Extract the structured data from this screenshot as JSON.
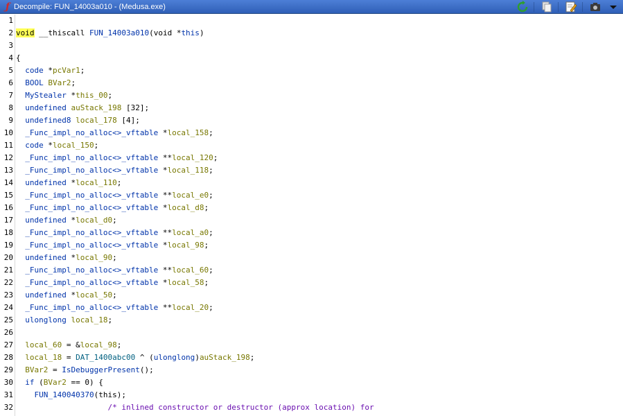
{
  "window": {
    "title": "Decompile: FUN_14003a010 -  (Medusa.exe)",
    "icon": "function-f-icon",
    "toolbar_icons": [
      "refresh-icon",
      "copy-icon",
      "edit-icon",
      "snapshot-icon",
      "dropdown-arrow-icon"
    ]
  },
  "colors": {
    "titlebar": "#2f5fb7",
    "keyword": "#0033aa",
    "variable": "#777700",
    "global": "#006080",
    "comment": "#6a0fb0",
    "highlight": "#ffff55"
  },
  "code": {
    "lines": [
      {
        "n": "1",
        "tokens": []
      },
      {
        "n": "2",
        "tokens": [
          [
            "hl",
            "void"
          ],
          [
            "t",
            " __thiscall "
          ],
          [
            "fn",
            "FUN_14003a010"
          ],
          [
            "t",
            "(void *"
          ],
          [
            "kw",
            "this"
          ],
          [
            "t",
            ")"
          ]
        ]
      },
      {
        "n": "3",
        "tokens": []
      },
      {
        "n": "4",
        "tokens": [
          [
            "t",
            "{"
          ]
        ]
      },
      {
        "n": "5",
        "tokens": [
          [
            "t",
            "  "
          ],
          [
            "ty",
            "code"
          ],
          [
            "t",
            " *"
          ],
          [
            "vr",
            "pcVar1"
          ],
          [
            "t",
            ";"
          ]
        ]
      },
      {
        "n": "6",
        "tokens": [
          [
            "t",
            "  "
          ],
          [
            "ty",
            "BOOL"
          ],
          [
            "t",
            " "
          ],
          [
            "vr",
            "BVar2"
          ],
          [
            "t",
            ";"
          ]
        ]
      },
      {
        "n": "7",
        "tokens": [
          [
            "t",
            "  "
          ],
          [
            "ty",
            "MyStealer"
          ],
          [
            "t",
            " *"
          ],
          [
            "vr",
            "this_00"
          ],
          [
            "t",
            ";"
          ]
        ]
      },
      {
        "n": "8",
        "tokens": [
          [
            "t",
            "  "
          ],
          [
            "ty",
            "undefined"
          ],
          [
            "t",
            " "
          ],
          [
            "vr",
            "auStack_198"
          ],
          [
            "t",
            " [32];"
          ]
        ]
      },
      {
        "n": "9",
        "tokens": [
          [
            "t",
            "  "
          ],
          [
            "ty",
            "undefined8"
          ],
          [
            "t",
            " "
          ],
          [
            "vr",
            "local_178"
          ],
          [
            "t",
            " [4];"
          ]
        ]
      },
      {
        "n": "10",
        "tokens": [
          [
            "t",
            "  "
          ],
          [
            "ty",
            "_Func_impl_no_alloc<>_vftable"
          ],
          [
            "t",
            " *"
          ],
          [
            "vr",
            "local_158"
          ],
          [
            "t",
            ";"
          ]
        ]
      },
      {
        "n": "11",
        "tokens": [
          [
            "t",
            "  "
          ],
          [
            "ty",
            "code"
          ],
          [
            "t",
            " *"
          ],
          [
            "vr",
            "local_150"
          ],
          [
            "t",
            ";"
          ]
        ]
      },
      {
        "n": "12",
        "tokens": [
          [
            "t",
            "  "
          ],
          [
            "ty",
            "_Func_impl_no_alloc<>_vftable"
          ],
          [
            "t",
            " **"
          ],
          [
            "vr",
            "local_120"
          ],
          [
            "t",
            ";"
          ]
        ]
      },
      {
        "n": "13",
        "tokens": [
          [
            "t",
            "  "
          ],
          [
            "ty",
            "_Func_impl_no_alloc<>_vftable"
          ],
          [
            "t",
            " *"
          ],
          [
            "vr",
            "local_118"
          ],
          [
            "t",
            ";"
          ]
        ]
      },
      {
        "n": "14",
        "tokens": [
          [
            "t",
            "  "
          ],
          [
            "ty",
            "undefined"
          ],
          [
            "t",
            " *"
          ],
          [
            "vr",
            "local_110"
          ],
          [
            "t",
            ";"
          ]
        ]
      },
      {
        "n": "15",
        "tokens": [
          [
            "t",
            "  "
          ],
          [
            "ty",
            "_Func_impl_no_alloc<>_vftable"
          ],
          [
            "t",
            " **"
          ],
          [
            "vr",
            "local_e0"
          ],
          [
            "t",
            ";"
          ]
        ]
      },
      {
        "n": "16",
        "tokens": [
          [
            "t",
            "  "
          ],
          [
            "ty",
            "_Func_impl_no_alloc<>_vftable"
          ],
          [
            "t",
            " *"
          ],
          [
            "vr",
            "local_d8"
          ],
          [
            "t",
            ";"
          ]
        ]
      },
      {
        "n": "17",
        "tokens": [
          [
            "t",
            "  "
          ],
          [
            "ty",
            "undefined"
          ],
          [
            "t",
            " *"
          ],
          [
            "vr",
            "local_d0"
          ],
          [
            "t",
            ";"
          ]
        ]
      },
      {
        "n": "18",
        "tokens": [
          [
            "t",
            "  "
          ],
          [
            "ty",
            "_Func_impl_no_alloc<>_vftable"
          ],
          [
            "t",
            " **"
          ],
          [
            "vr",
            "local_a0"
          ],
          [
            "t",
            ";"
          ]
        ]
      },
      {
        "n": "19",
        "tokens": [
          [
            "t",
            "  "
          ],
          [
            "ty",
            "_Func_impl_no_alloc<>_vftable"
          ],
          [
            "t",
            " *"
          ],
          [
            "vr",
            "local_98"
          ],
          [
            "t",
            ";"
          ]
        ]
      },
      {
        "n": "20",
        "tokens": [
          [
            "t",
            "  "
          ],
          [
            "ty",
            "undefined"
          ],
          [
            "t",
            " *"
          ],
          [
            "vr",
            "local_90"
          ],
          [
            "t",
            ";"
          ]
        ]
      },
      {
        "n": "21",
        "tokens": [
          [
            "t",
            "  "
          ],
          [
            "ty",
            "_Func_impl_no_alloc<>_vftable"
          ],
          [
            "t",
            " **"
          ],
          [
            "vr",
            "local_60"
          ],
          [
            "t",
            ";"
          ]
        ]
      },
      {
        "n": "22",
        "tokens": [
          [
            "t",
            "  "
          ],
          [
            "ty",
            "_Func_impl_no_alloc<>_vftable"
          ],
          [
            "t",
            " *"
          ],
          [
            "vr",
            "local_58"
          ],
          [
            "t",
            ";"
          ]
        ]
      },
      {
        "n": "23",
        "tokens": [
          [
            "t",
            "  "
          ],
          [
            "ty",
            "undefined"
          ],
          [
            "t",
            " *"
          ],
          [
            "vr",
            "local_50"
          ],
          [
            "t",
            ";"
          ]
        ]
      },
      {
        "n": "24",
        "tokens": [
          [
            "t",
            "  "
          ],
          [
            "ty",
            "_Func_impl_no_alloc<>_vftable"
          ],
          [
            "t",
            " **"
          ],
          [
            "vr",
            "local_20"
          ],
          [
            "t",
            ";"
          ]
        ]
      },
      {
        "n": "25",
        "tokens": [
          [
            "t",
            "  "
          ],
          [
            "ty",
            "ulonglong"
          ],
          [
            "t",
            " "
          ],
          [
            "vr",
            "local_18"
          ],
          [
            "t",
            ";"
          ]
        ]
      },
      {
        "n": "26",
        "tokens": []
      },
      {
        "n": "27",
        "tokens": [
          [
            "t",
            "  "
          ],
          [
            "vr",
            "local_60"
          ],
          [
            "t",
            " = &"
          ],
          [
            "vr",
            "local_98"
          ],
          [
            "t",
            ";"
          ]
        ]
      },
      {
        "n": "28",
        "tokens": [
          [
            "t",
            "  "
          ],
          [
            "vr",
            "local_18"
          ],
          [
            "t",
            " = "
          ],
          [
            "gl",
            "DAT_1400abc00"
          ],
          [
            "t",
            " ^ ("
          ],
          [
            "ty",
            "ulonglong"
          ],
          [
            "t",
            ")"
          ],
          [
            "vr",
            "auStack_198"
          ],
          [
            "t",
            ";"
          ]
        ]
      },
      {
        "n": "29",
        "tokens": [
          [
            "t",
            "  "
          ],
          [
            "vr",
            "BVar2"
          ],
          [
            "t",
            " = "
          ],
          [
            "fn",
            "IsDebuggerPresent"
          ],
          [
            "t",
            "();"
          ]
        ]
      },
      {
        "n": "30",
        "tokens": [
          [
            "t",
            "  "
          ],
          [
            "kw",
            "if"
          ],
          [
            "t",
            " ("
          ],
          [
            "vr",
            "BVar2"
          ],
          [
            "t",
            " == 0) {"
          ]
        ]
      },
      {
        "n": "31",
        "tokens": [
          [
            "t",
            "    "
          ],
          [
            "fn",
            "FUN_140040370"
          ],
          [
            "t",
            "(this);"
          ]
        ]
      },
      {
        "n": "32",
        "tokens": [
          [
            "t",
            "                    "
          ],
          [
            "cm",
            "/* inlined constructor or destructor (approx location) for"
          ]
        ]
      }
    ]
  }
}
